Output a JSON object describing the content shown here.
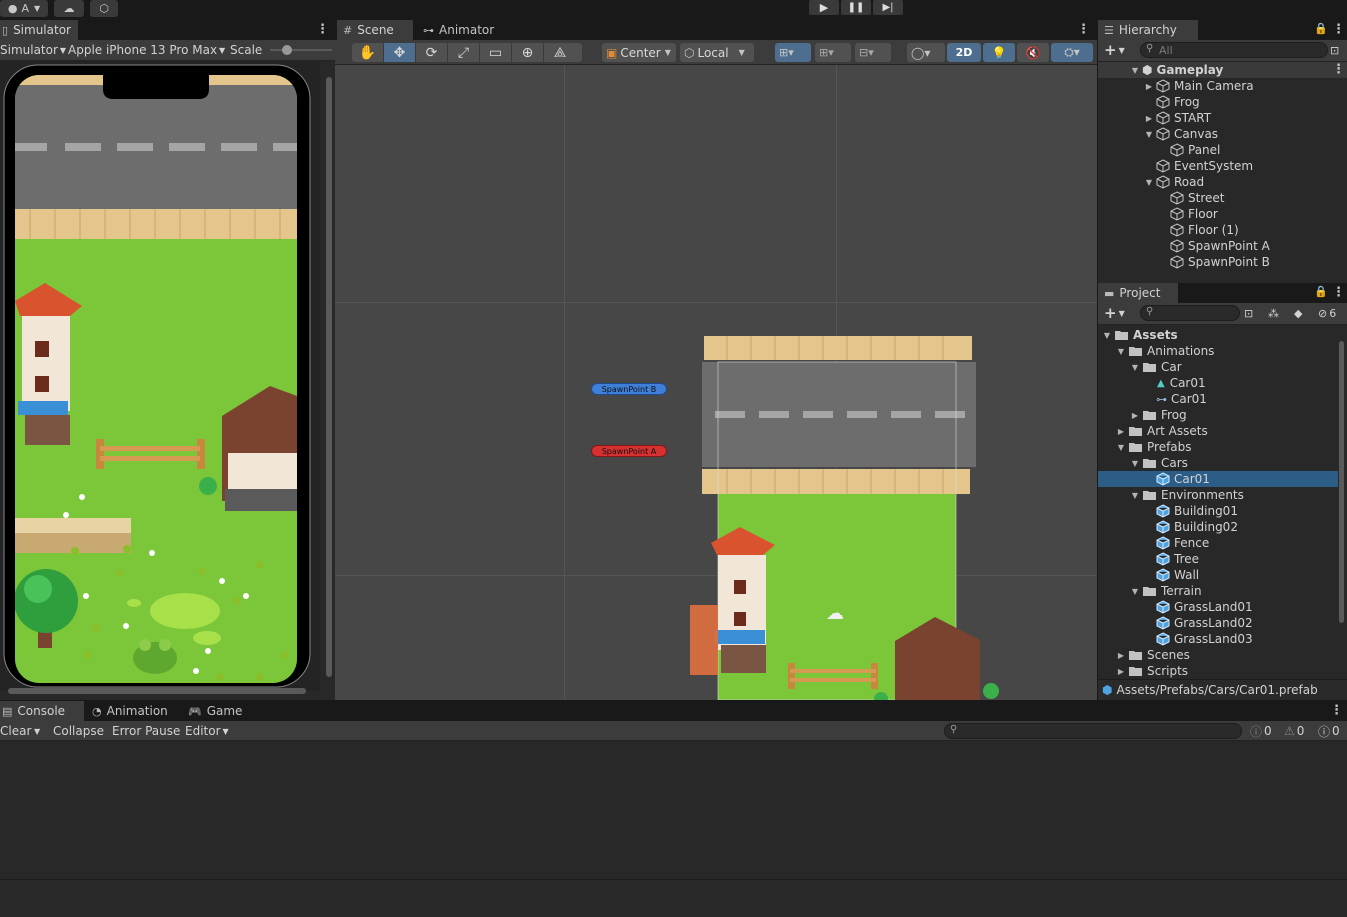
{
  "topbar": {
    "account_label": "A",
    "play_icons": [
      "play-icon",
      "pause-icon",
      "step-icon"
    ]
  },
  "simulator": {
    "tab_label": "Simulator",
    "mode_label": "Simulator",
    "device_label": "Apple iPhone 13 Pro Max",
    "scale_label": "Scale",
    "scale_value": 0.27
  },
  "scene": {
    "tab_label": "Scene",
    "animator_tab_label": "Animator",
    "pivot_label": "Center",
    "space_label": "Local",
    "mode_2d_label": "2D",
    "spawn_b_label": "SpawnPoint B",
    "spawn_a_label": "SpawnPoint A"
  },
  "hierarchy": {
    "tab_label": "Hierarchy",
    "search_placeholder": "All",
    "scene_name": "Gameplay",
    "items": [
      {
        "label": "Main Camera",
        "depth": 1,
        "arrow": "right"
      },
      {
        "label": "Frog",
        "depth": 1,
        "arrow": ""
      },
      {
        "label": "START",
        "depth": 1,
        "arrow": "right"
      },
      {
        "label": "Canvas",
        "depth": 1,
        "arrow": "down"
      },
      {
        "label": "Panel",
        "depth": 2,
        "arrow": ""
      },
      {
        "label": "EventSystem",
        "depth": 1,
        "arrow": ""
      },
      {
        "label": "Road",
        "depth": 1,
        "arrow": "down"
      },
      {
        "label": "Street",
        "depth": 2,
        "arrow": ""
      },
      {
        "label": "Floor",
        "depth": 2,
        "arrow": ""
      },
      {
        "label": "Floor (1)",
        "depth": 2,
        "arrow": ""
      },
      {
        "label": "SpawnPoint A",
        "depth": 2,
        "arrow": ""
      },
      {
        "label": "SpawnPoint B",
        "depth": 2,
        "arrow": ""
      }
    ]
  },
  "project": {
    "tab_label": "Project",
    "hidden_count": "6",
    "items": [
      {
        "label": "Assets",
        "depth": 0,
        "arrow": "down",
        "type": "folder",
        "bold": true
      },
      {
        "label": "Animations",
        "depth": 1,
        "arrow": "down",
        "type": "folder"
      },
      {
        "label": "Car",
        "depth": 2,
        "arrow": "down",
        "type": "folder"
      },
      {
        "label": "Car01",
        "depth": 3,
        "arrow": "",
        "type": "anim"
      },
      {
        "label": "Car01",
        "depth": 3,
        "arrow": "",
        "type": "controller"
      },
      {
        "label": "Frog",
        "depth": 2,
        "arrow": "right",
        "type": "folder"
      },
      {
        "label": "Art Assets",
        "depth": 1,
        "arrow": "right",
        "type": "folder"
      },
      {
        "label": "Prefabs",
        "depth": 1,
        "arrow": "down",
        "type": "folder"
      },
      {
        "label": "Cars",
        "depth": 2,
        "arrow": "down",
        "type": "folder"
      },
      {
        "label": "Car01",
        "depth": 3,
        "arrow": "",
        "type": "prefab",
        "selected": true
      },
      {
        "label": "Environments",
        "depth": 2,
        "arrow": "down",
        "type": "folder"
      },
      {
        "label": "Building01",
        "depth": 3,
        "arrow": "",
        "type": "prefab"
      },
      {
        "label": "Building02",
        "depth": 3,
        "arrow": "",
        "type": "prefab"
      },
      {
        "label": "Fence",
        "depth": 3,
        "arrow": "",
        "type": "prefab"
      },
      {
        "label": "Tree",
        "depth": 3,
        "arrow": "",
        "type": "prefab"
      },
      {
        "label": "Wall",
        "depth": 3,
        "arrow": "",
        "type": "prefab"
      },
      {
        "label": "Terrain",
        "depth": 2,
        "arrow": "down",
        "type": "folder"
      },
      {
        "label": "GrassLand01",
        "depth": 3,
        "arrow": "",
        "type": "prefab"
      },
      {
        "label": "GrassLand02",
        "depth": 3,
        "arrow": "",
        "type": "prefab"
      },
      {
        "label": "GrassLand03",
        "depth": 3,
        "arrow": "",
        "type": "prefab"
      },
      {
        "label": "Scenes",
        "depth": 1,
        "arrow": "right",
        "type": "folder"
      },
      {
        "label": "Scripts",
        "depth": 1,
        "arrow": "right",
        "type": "folder"
      }
    ],
    "path": "Assets/Prefabs/Cars/Car01.prefab"
  },
  "bottom": {
    "console_tab": "Console",
    "animation_tab": "Animation",
    "game_tab": "Game",
    "clear_label": "Clear",
    "collapse_label": "Collapse",
    "error_pause_label": "Error Pause",
    "editor_label": "Editor",
    "log_count": "0",
    "warn_count": "0",
    "error_count": "0"
  },
  "colors": {
    "selection": "#2c5d87",
    "prefab": "#4fa3e0",
    "grass": "#7cc63a",
    "road": "#6d6d6d",
    "sidewalk": "#e4c58c"
  }
}
